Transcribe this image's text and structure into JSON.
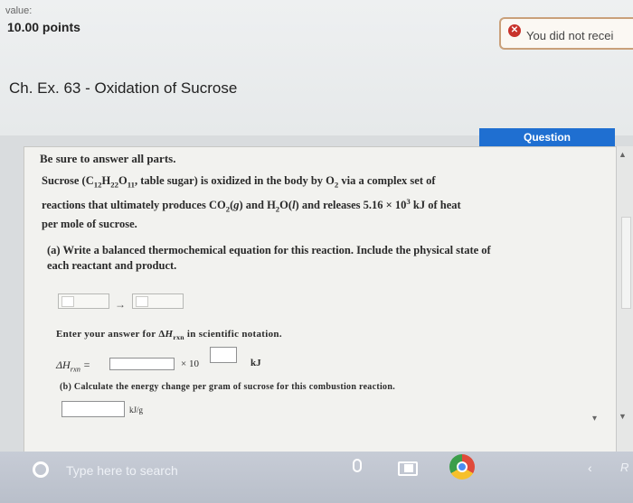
{
  "header": {
    "value_label": "value:",
    "points": "10.00 points",
    "alert_text": "You did not recei",
    "alert_icon": "x-circle-icon"
  },
  "title": "Ch. Ex. 63 - Oxidation of Sucrose",
  "question_tab": "Question",
  "problem": {
    "instruction": "Be sure to answer all parts.",
    "heat_value": "5.16",
    "part_b": "(b) Calculate the energy change per gram of sucrose for this combustion reaction.",
    "sci_notation_prompt_end": "in scientific notation.",
    "times_ten": "× 10",
    "unit_kj": "kJ",
    "unit_kj_per_g": "kJ/g"
  },
  "taskbar": {
    "search_placeholder": "Type here to search",
    "system_text": "R"
  },
  "colors": {
    "accent_blue": "#1f6fd1",
    "alert_red": "#c8322b"
  }
}
